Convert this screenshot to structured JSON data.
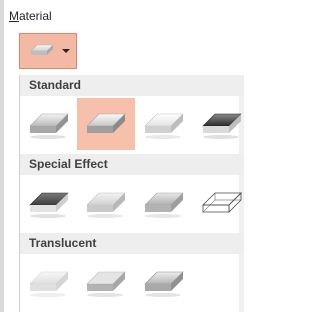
{
  "header": {
    "label_underlined": "M",
    "label_rest": "aterial"
  },
  "dropdown": {
    "caret": "chevron-down-icon"
  },
  "sections": [
    {
      "title": "Standard",
      "items": [
        {
          "name": "matte",
          "selected": false
        },
        {
          "name": "warm-matte",
          "selected": true
        },
        {
          "name": "plastic",
          "selected": false
        },
        {
          "name": "metal",
          "selected": false
        }
      ]
    },
    {
      "title": "Special Effect",
      "items": [
        {
          "name": "dark-edge",
          "selected": false
        },
        {
          "name": "soft-edge",
          "selected": false
        },
        {
          "name": "flat",
          "selected": false
        },
        {
          "name": "wire-frame",
          "selected": false
        }
      ]
    },
    {
      "title": "Translucent",
      "items": [
        {
          "name": "powder",
          "selected": false
        },
        {
          "name": "clear",
          "selected": false
        },
        {
          "name": "soft-metal",
          "selected": false
        }
      ]
    }
  ],
  "colors": {
    "accent": "#f6c0ab",
    "accent_border": "#e2866a",
    "section_bg": "#eeeeee"
  }
}
